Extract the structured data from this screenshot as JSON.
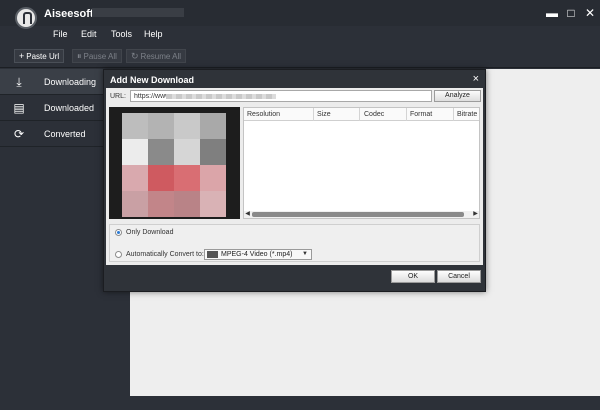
{
  "app": {
    "title": "Aiseesoft"
  },
  "window_controls": {
    "minimize": "▬",
    "maximize": "□",
    "close": "✕"
  },
  "menu": [
    "File",
    "Edit",
    "Tools",
    "Help"
  ],
  "toolbar": {
    "paste_url": "Paste Url",
    "pause_all": "Pause All",
    "resume_all": "Resume All"
  },
  "sidebar": {
    "items": [
      {
        "label": "Downloading",
        "icon": "download-icon",
        "active": true
      },
      {
        "label": "Downloaded",
        "icon": "film-icon",
        "active": false
      },
      {
        "label": "Converted",
        "icon": "convert-icon",
        "active": false
      }
    ]
  },
  "dialog": {
    "title": "Add New Download",
    "close": "×",
    "url_label": "URL:",
    "url_value": "https://www.",
    "analyze_label": "Analyze",
    "columns": [
      "Resolution",
      "Size",
      "Codec",
      "Format",
      "Bitrate"
    ],
    "option_only_download": "Only Download",
    "option_auto_convert": "Automatically Convert to:",
    "selected_mode": "Only Download",
    "format_value": "MPEG-4 Video (*.mp4)",
    "ok_label": "OK",
    "cancel_label": "Cancel"
  },
  "colors": {
    "background_dark": "#2c3038",
    "content_light": "#eeeeee",
    "accent_blue": "#2a7ad5"
  }
}
